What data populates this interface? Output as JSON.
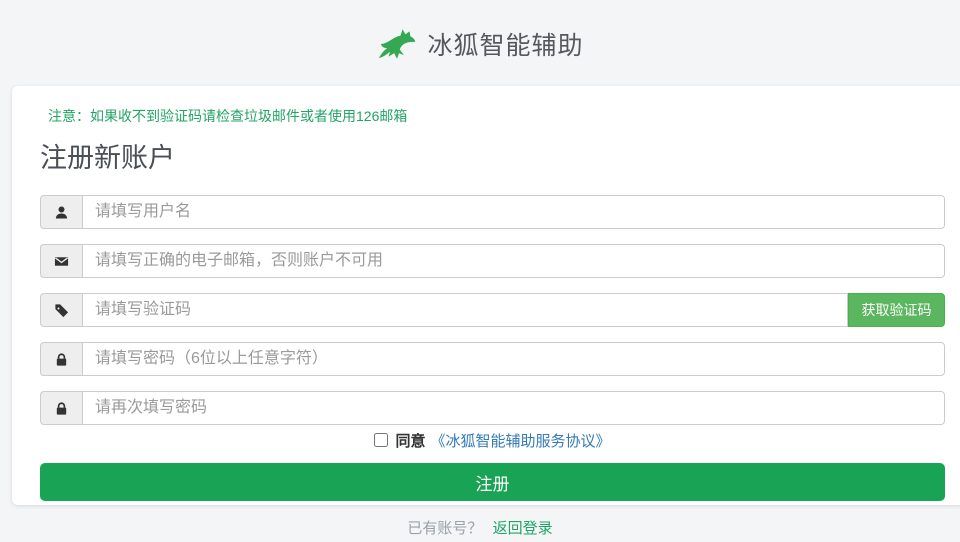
{
  "header": {
    "title": "冰狐智能辅助",
    "logo_icon": "fox-logo-icon",
    "logo_color": "#34a853"
  },
  "card": {
    "notice": "注意：如果收不到验证码请检查垃圾邮件或者使用126邮箱",
    "notice_color": "#22a465",
    "heading": "注册新账户",
    "fields": [
      {
        "icon": "user-icon",
        "placeholder": "请填写用户名"
      },
      {
        "icon": "envelope-icon",
        "placeholder": "请填写正确的电子邮箱，否则账户不可用"
      },
      {
        "icon": "tag-icon",
        "placeholder": "请填写验证码",
        "button_label": "获取验证码",
        "button_color": "#5bb75f"
      },
      {
        "icon": "lock-icon",
        "placeholder": "请填写密码（6位以上任意字符）"
      },
      {
        "icon": "lock-icon",
        "placeholder": "请再次填写密码"
      }
    ],
    "agreement": {
      "checked": false,
      "label": "同意",
      "link": "《冰狐智能辅助服务协议》",
      "link_color": "#337ab7"
    },
    "submit": {
      "label": "注册",
      "color": "#19a355"
    }
  },
  "footer": {
    "question": "已有账号？",
    "link": "返回登录",
    "link_color": "#22a465"
  }
}
